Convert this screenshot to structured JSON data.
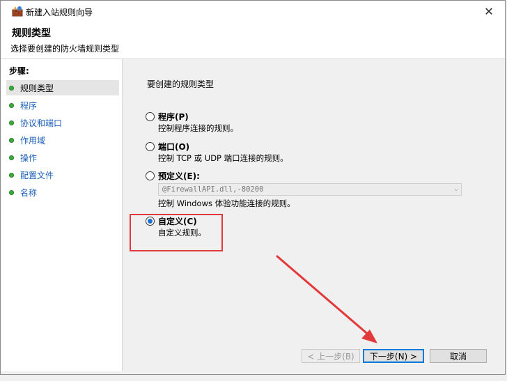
{
  "window": {
    "title": "新建入站规则向导",
    "close_glyph": "✕"
  },
  "header": {
    "title": "规则类型",
    "subtitle": "选择要创建的防火墙规则类型"
  },
  "sidebar": {
    "label": "步骤:",
    "items": [
      {
        "label": "规则类型",
        "active": true
      },
      {
        "label": "程序",
        "active": false
      },
      {
        "label": "协议和端口",
        "active": false
      },
      {
        "label": "作用域",
        "active": false
      },
      {
        "label": "操作",
        "active": false
      },
      {
        "label": "配置文件",
        "active": false
      },
      {
        "label": "名称",
        "active": false
      }
    ]
  },
  "main": {
    "prompt": "要创建的规则类型",
    "options": [
      {
        "label": "程序(P)",
        "desc": "控制程序连接的规则。",
        "selected": false
      },
      {
        "label": "端口(O)",
        "desc": "控制 TCP 或 UDP 端口连接的规则。",
        "selected": false
      },
      {
        "label": "预定义(E):",
        "desc": "控制 Windows 体验功能连接的规则。",
        "selected": false
      },
      {
        "label": "自定义(C)",
        "desc": "自定义规则。",
        "selected": true
      }
    ],
    "predefined_select": {
      "value": "@FirewallAPI.dll,-80200",
      "disabled": true
    }
  },
  "buttons": {
    "back": "< 上一步(B)",
    "next": "下一步(N) >",
    "cancel": "取消"
  },
  "colors": {
    "annotation": "#e23a3a",
    "step_dot": "#3caa3c",
    "accent": "#0078d7"
  }
}
